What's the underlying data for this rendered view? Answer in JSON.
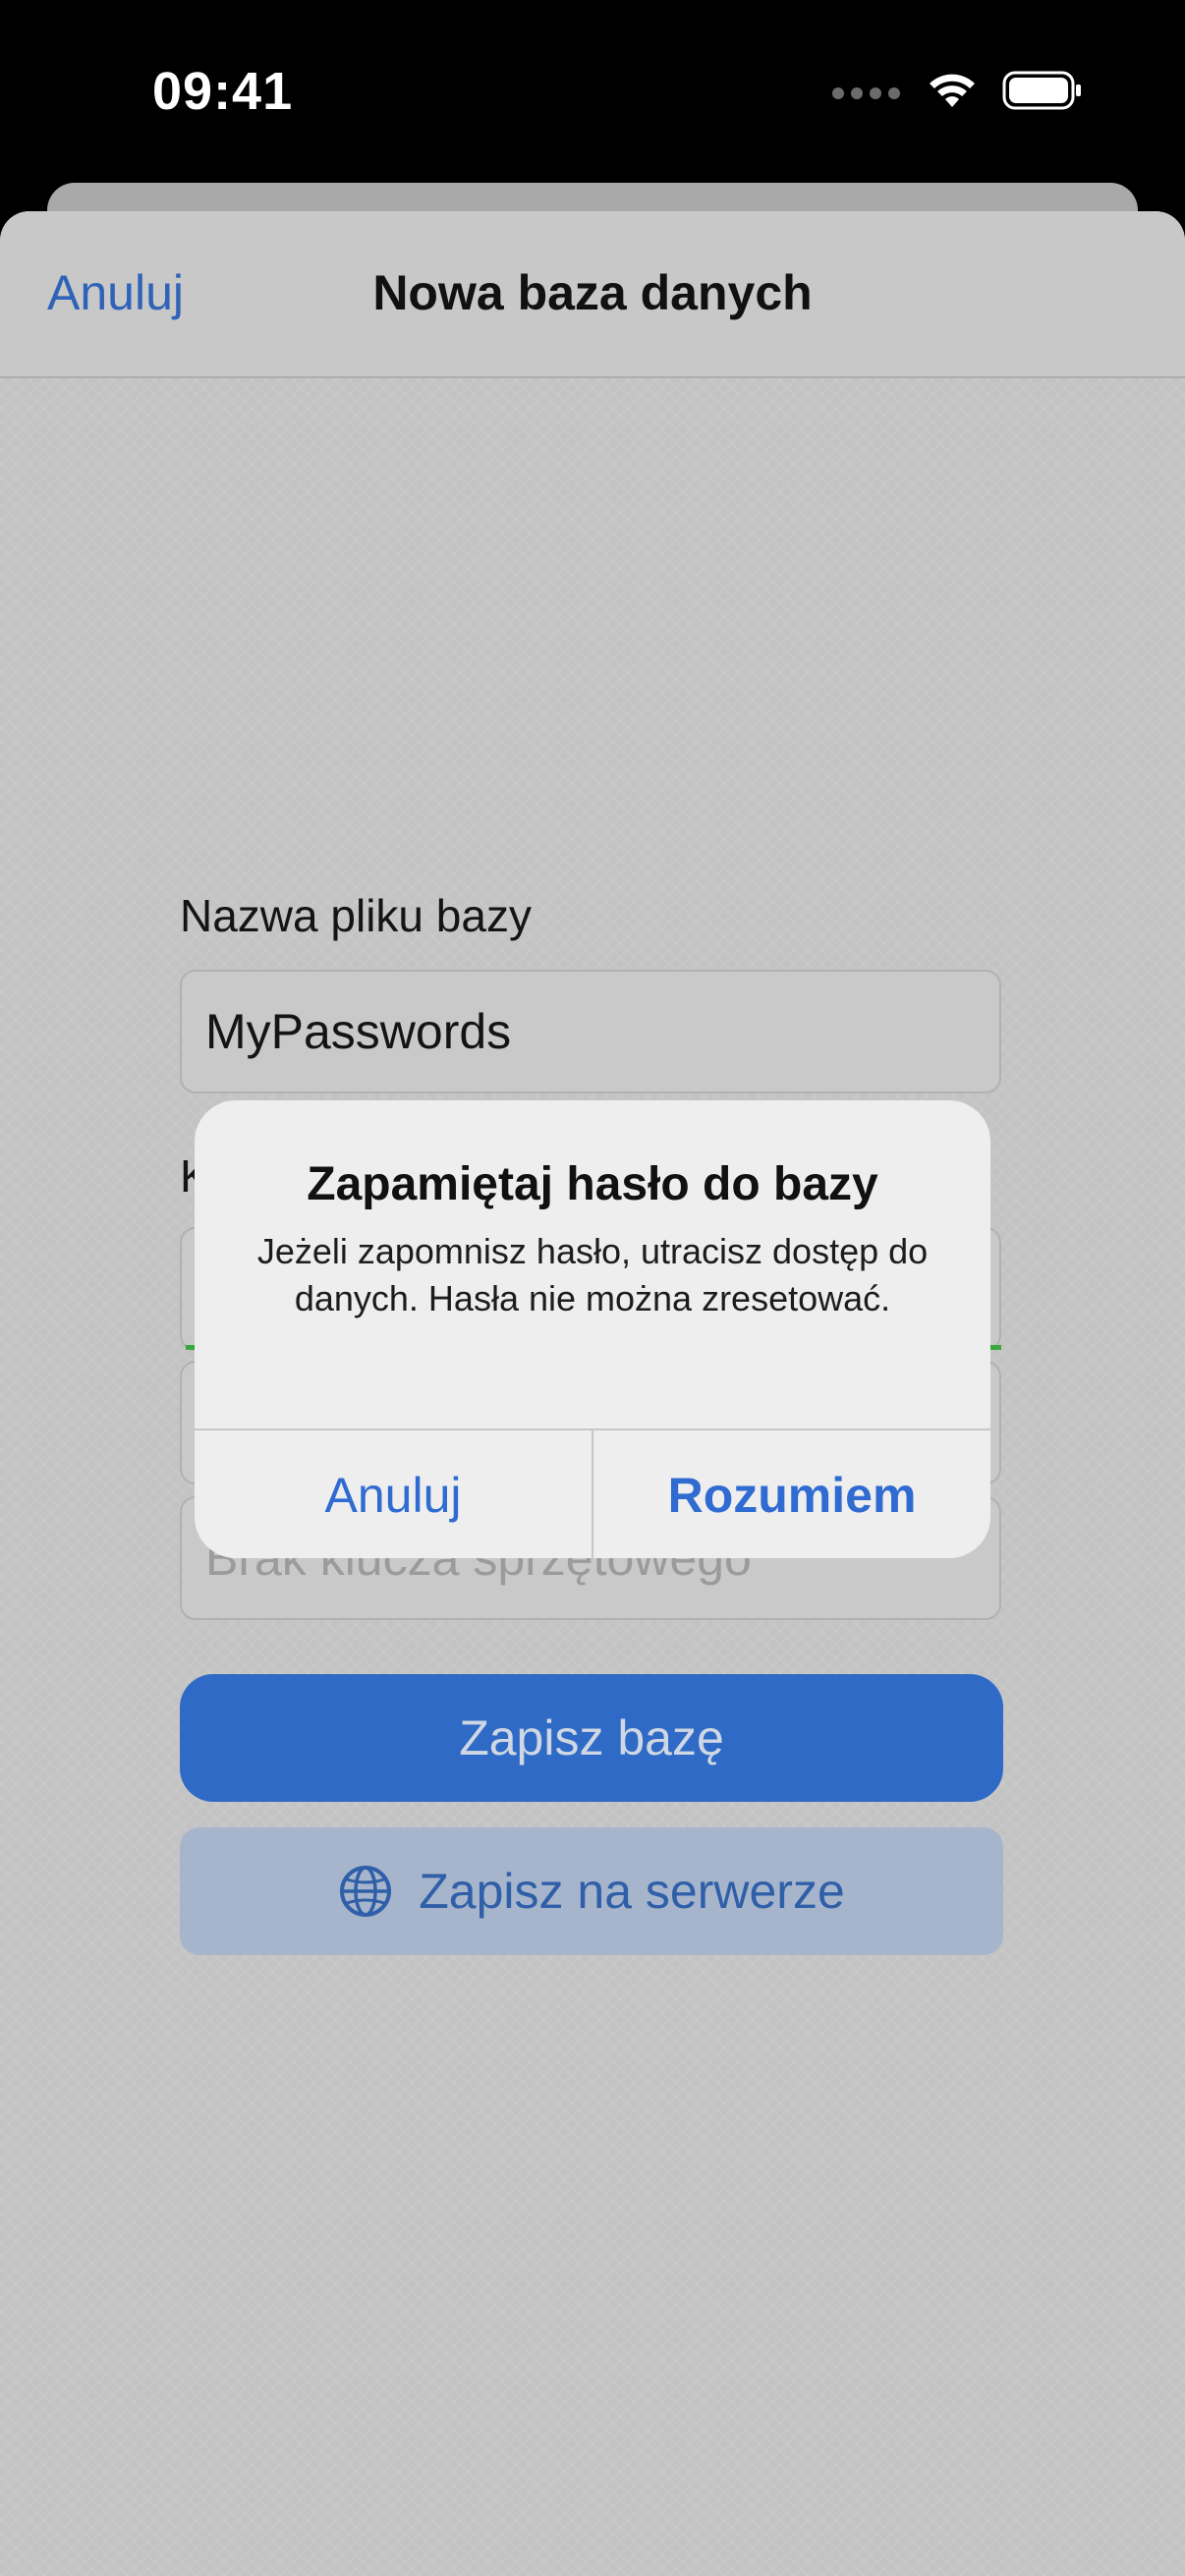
{
  "status_bar": {
    "time": "09:41",
    "icons": [
      "signal-icon",
      "wifi-icon",
      "battery-icon"
    ]
  },
  "nav": {
    "cancel_label": "Anuluj",
    "title": "Nowa baza danych"
  },
  "form": {
    "filename_label": "Nazwa pliku bazy",
    "filename_value": "MyPasswords",
    "password_label_fragment": "K",
    "hardware_key_placeholder": "Brak klucza sprzętowego",
    "save_label": "Zapisz bazę",
    "save_server_label": "Zapisz na serwerze",
    "save_server_icon": "globe-icon",
    "strength_color": "#39a83a"
  },
  "alert": {
    "title": "Zapamiętaj hasło do bazy",
    "message": "Jeżeli zapomnisz hasło, utracisz dostęp do danych. Hasła nie można zresetować.",
    "cancel_label": "Anuluj",
    "confirm_label": "Rozumiem"
  },
  "colors": {
    "accent": "#2f6bd1",
    "primary_button": "#2f6ac6",
    "overlay_background": "#c3c3c3",
    "alert_background": "#eeeeee"
  }
}
